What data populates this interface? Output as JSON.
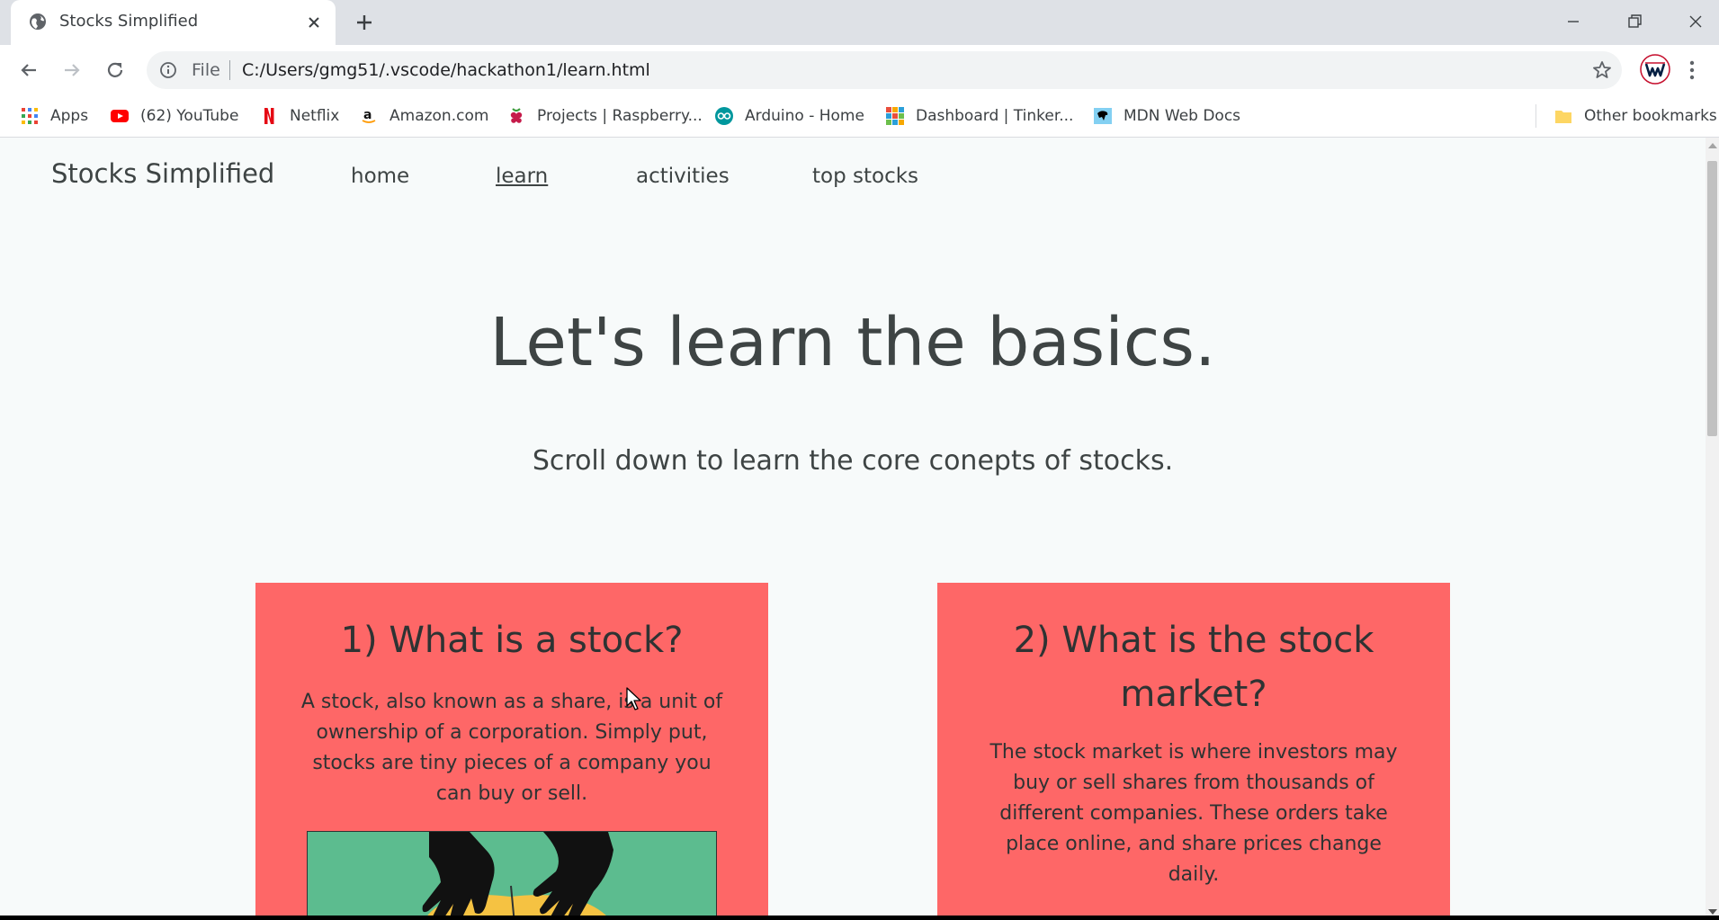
{
  "browser": {
    "tab_title": "Stocks Simplified",
    "omnibox": {
      "scheme_label": "File",
      "url": "C:/Users/gmg51/.vscode/hackathon1/learn.html"
    },
    "bookmarks": [
      {
        "label": "Apps",
        "icon": "apps-grid-icon"
      },
      {
        "label": "(62) YouTube",
        "icon": "youtube-icon"
      },
      {
        "label": "Netflix",
        "icon": "netflix-icon"
      },
      {
        "label": "Amazon.com",
        "icon": "amazon-icon"
      },
      {
        "label": "Projects | Raspberry...",
        "icon": "raspberry-pi-icon"
      },
      {
        "label": "Arduino - Home",
        "icon": "arduino-icon"
      },
      {
        "label": "Dashboard | Tinker...",
        "icon": "tinkercad-icon"
      },
      {
        "label": "MDN Web Docs",
        "icon": "mdn-icon"
      }
    ],
    "other_bookmarks": "Other bookmarks"
  },
  "site": {
    "brand": "Stocks Simplified",
    "nav": [
      {
        "label": "home",
        "active": false
      },
      {
        "label": "learn",
        "active": true
      },
      {
        "label": "activities",
        "active": false
      },
      {
        "label": "top stocks",
        "active": false
      }
    ],
    "hero": {
      "title": "Let's learn the basics.",
      "subtitle": "Scroll down to learn the core conepts of stocks."
    },
    "cards": [
      {
        "title": "1) What is a stock?",
        "body": "A stock, also known as a share, is a unit of ownership of a corporation. Simply put, stocks are tiny pieces of a company you can buy or sell."
      },
      {
        "title": "2) What is the stock market?",
        "body": "The stock market is where investors may buy or sell shares from thousands of different companies. These orders take place online, and share prices change daily."
      }
    ]
  },
  "colors": {
    "card_bg": "#fe6767",
    "page_bg": "#f7fafa",
    "text": "#3e4444",
    "image_bg": "#5cbc8f"
  }
}
